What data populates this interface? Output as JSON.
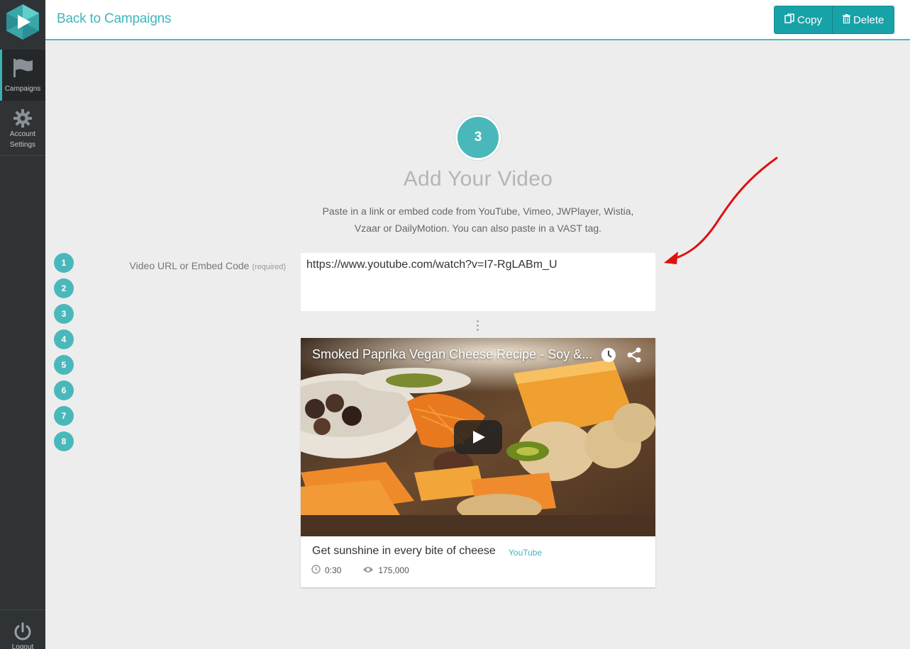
{
  "sidebar": {
    "items": [
      {
        "label": "Campaigns",
        "icon": "flag-icon"
      },
      {
        "label": "Account Settings",
        "icon": "gear-icon"
      }
    ],
    "logout_label": "Logout"
  },
  "header": {
    "back_label": "Back to Campaigns",
    "copy_label": "Copy",
    "delete_label": "Delete"
  },
  "step": {
    "current": "3",
    "title": "Add Your Video",
    "subtitle_line1": "Paste in a link or embed code from YouTube, Vimeo, JWPlayer, Wistia,",
    "subtitle_line2": "Vzaar or DailyMotion. You can also paste in a VAST tag.",
    "numbers": [
      "1",
      "2",
      "3",
      "4",
      "5",
      "6",
      "7",
      "8"
    ]
  },
  "form": {
    "label": "Video URL or Embed Code",
    "required_label": "(required)",
    "value": "https://www.youtube.com/watch?v=I7-RgLABm_U"
  },
  "video": {
    "overlay_title": "Smoked Paprika Vegan Cheese Recipe - Soy &...",
    "title": "Get sunshine in every bite of cheese",
    "source": "YouTube",
    "duration": "0:30",
    "views": "175,000"
  },
  "colors": {
    "accent": "#3fb6bd",
    "sidebar_bg": "#2f3336",
    "button_bg": "#17a2a8",
    "annotation_arrow": "#e01010"
  }
}
